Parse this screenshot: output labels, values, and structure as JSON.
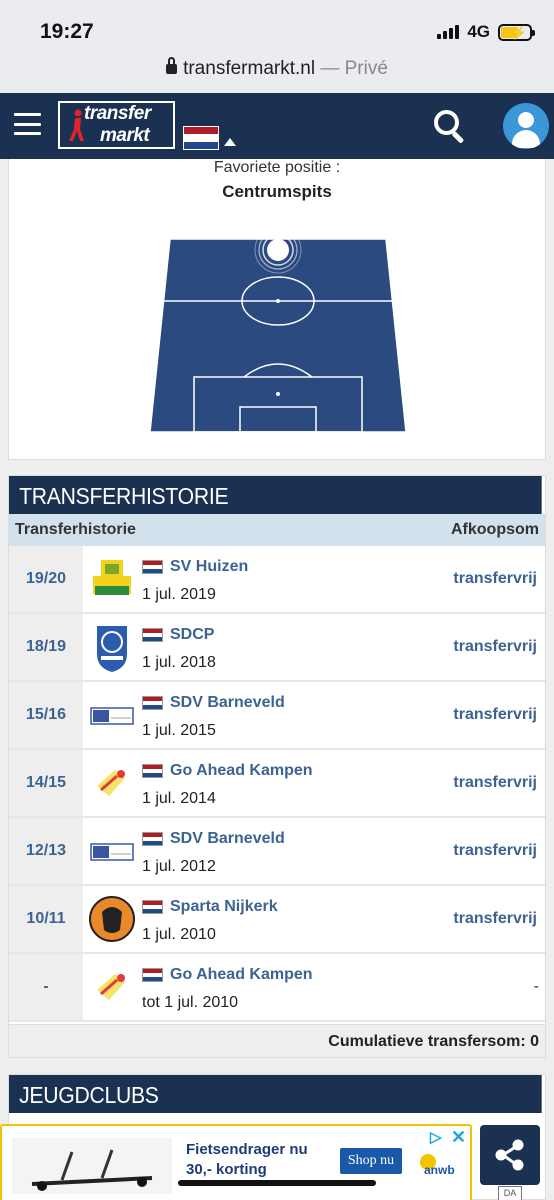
{
  "status": {
    "time": "19:27",
    "network": "4G"
  },
  "browser": {
    "domain": "transfermarkt.nl",
    "separator": " — ",
    "mode": "Privé"
  },
  "header": {
    "logo_top": "transfer",
    "logo_bottom": "markt"
  },
  "position": {
    "label": "Favoriete positie :",
    "value": "Centrumspits"
  },
  "transfers": {
    "section_title": "TRANSFERHISTORIE",
    "col_history": "Transferhistorie",
    "col_fee": "Afkoopsom",
    "rows": [
      {
        "season": "19/20",
        "club": "SV Huizen",
        "date": "1 jul. 2019",
        "fee": "transfervrij",
        "crest": "huizen"
      },
      {
        "season": "18/19",
        "club": "SDCP",
        "date": "1 jul. 2018",
        "fee": "transfervrij",
        "crest": "sdcp"
      },
      {
        "season": "15/16",
        "club": "SDV Barneveld",
        "date": "1 jul. 2015",
        "fee": "transfervrij",
        "crest": "sdv"
      },
      {
        "season": "14/15",
        "club": "Go Ahead Kampen",
        "date": "1 jul. 2014",
        "fee": "transfervrij",
        "crest": "gak"
      },
      {
        "season": "12/13",
        "club": "SDV Barneveld",
        "date": "1 jul. 2012",
        "fee": "transfervrij",
        "crest": "sdv"
      },
      {
        "season": "10/11",
        "club": "Sparta Nijkerk",
        "date": "1 jul. 2010",
        "fee": "transfervrij",
        "crest": "sparta"
      },
      {
        "season": "-",
        "club": "Go Ahead Kampen",
        "date": "tot 1 jul. 2010",
        "fee": "-",
        "crest": "gak"
      }
    ],
    "total": "Cumulatieve transfersom: 0"
  },
  "youth": {
    "section_title": "JEUGDCLUBS"
  },
  "ad": {
    "text": "Fietsendrager nu 30,- korting",
    "button": "Shop nu",
    "brand": "anwb"
  },
  "badge": "DA"
}
